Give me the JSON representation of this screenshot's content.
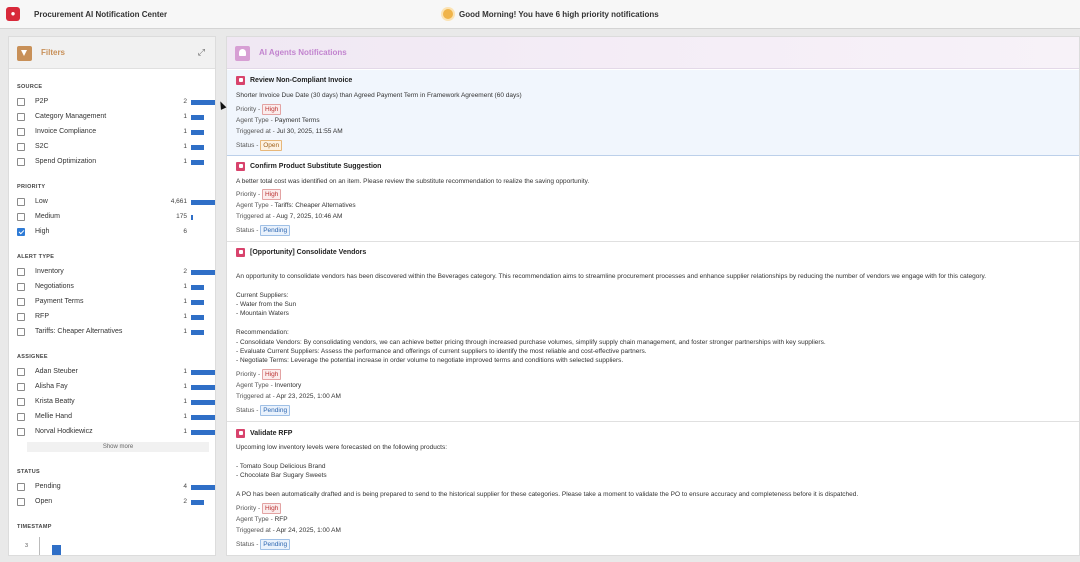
{
  "app": {
    "title": "Procurement AI Notification Center",
    "greeting": "Good Morning! You have 6 high priority notifications"
  },
  "colors": {
    "brand": "#d8293a",
    "filter_accent": "#c89058",
    "notif_accent": "#c284cf",
    "bar": "#2f6fc7",
    "priority_icon": "#d8436c"
  },
  "filters": {
    "title": "Filters",
    "show_more": "Show more",
    "source": {
      "title": "SOURCE",
      "items": [
        {
          "label": "P2P",
          "count": "2",
          "value": 2
        },
        {
          "label": "Category Management",
          "count": "1",
          "value": 1
        },
        {
          "label": "Invoice Compliance",
          "count": "1",
          "value": 1
        },
        {
          "label": "S2C",
          "count": "1",
          "value": 1
        },
        {
          "label": "Spend Optimization",
          "count": "1",
          "value": 1
        }
      ]
    },
    "priority": {
      "title": "PRIORITY",
      "items": [
        {
          "label": "Low",
          "count": "4,661",
          "value": 4661,
          "checked": false
        },
        {
          "label": "Medium",
          "count": "175",
          "value": 175,
          "checked": false
        },
        {
          "label": "High",
          "count": "6",
          "value": 6,
          "checked": true
        }
      ]
    },
    "alert_type": {
      "title": "ALERT TYPE",
      "items": [
        {
          "label": "Inventory",
          "count": "2",
          "value": 2
        },
        {
          "label": "Negotiations",
          "count": "1",
          "value": 1
        },
        {
          "label": "Payment Terms",
          "count": "1",
          "value": 1
        },
        {
          "label": "RFP",
          "count": "1",
          "value": 1
        },
        {
          "label": "Tariffs: Cheaper Alternatives",
          "count": "1",
          "value": 1
        }
      ]
    },
    "assignee": {
      "title": "ASSIGNEE",
      "items": [
        {
          "label": "Adan Steuber",
          "count": "1",
          "value": 1
        },
        {
          "label": "Alisha Fay",
          "count": "1",
          "value": 1
        },
        {
          "label": "Krista Beatty",
          "count": "1",
          "value": 1
        },
        {
          "label": "Mellie Hand",
          "count": "1",
          "value": 1
        },
        {
          "label": "Norval Hodkiewicz",
          "count": "1",
          "value": 1
        }
      ]
    },
    "status": {
      "title": "STATUS",
      "items": [
        {
          "label": "Pending",
          "count": "4",
          "value": 4
        },
        {
          "label": "Open",
          "count": "2",
          "value": 2
        }
      ]
    },
    "timestamp": {
      "title": "TIMESTAMP",
      "axis_label": "3"
    }
  },
  "notifications": {
    "title": "AI Agents Notifications",
    "labels": {
      "priority": "Priority -",
      "agent_type": "Agent Type -",
      "triggered_at": "Triggered at -",
      "status": "Status -"
    },
    "cards": [
      {
        "title": "Review Non-Compliant Invoice",
        "body": [
          "Shorter Invoice Due Date  (30 days) than Agreed Payment Term in Framework Agreement (60 days)"
        ],
        "priority": "High",
        "agent_type": "Payment Terms",
        "triggered_at": "Jul 30, 2025, 11:55 AM",
        "status": "Open"
      },
      {
        "title": "Confirm Product Substitute Suggestion",
        "body": [
          "A better total cost was identified on an item. Please review the substitute recommendation to realize the saving opportunity."
        ],
        "priority": "High",
        "agent_type": "Tariffs: Cheaper Alternatives",
        "triggered_at": "Aug 7, 2025, 10:46 AM",
        "status": "Pending"
      },
      {
        "title": "[Opportunity] Consolidate Vendors",
        "body": [
          "An opportunity to consolidate vendors has been discovered within the Beverages category. This recommendation aims to streamline procurement processes and enhance supplier relationships by reducing the number of vendors we engage with for this category.",
          "Current Suppliers:",
          "- Water from the Sun",
          "- Mountain Waters",
          "Recommendation:",
          "- Consolidate Vendors: By consolidating vendors, we can achieve better pricing through increased purchase volumes, simplify supply chain management, and foster stronger partnerships with key suppliers.",
          "- Evaluate Current Suppliers: Assess the performance and offerings of current suppliers to identify the most reliable and cost-effective partners.",
          "- Negotiate Terms: Leverage the potential increase in order volume to negotiate improved terms and conditions with selected suppliers."
        ],
        "priority": "High",
        "agent_type": "Inventory",
        "triggered_at": "Apr 23, 2025, 1:00 AM",
        "status": "Pending"
      },
      {
        "title": "Validate RFP",
        "body": [
          "Upcoming low inventory levels were forecasted on the following products:",
          "- Tomato Soup Delicious Brand",
          "- Chocolate Bar Sugary Sweets",
          "A PO has been automatically drafted and is being prepared to send to the historical supplier for these categories. Please take a moment to validate the PO to ensure accuracy and completeness before it is dispatched."
        ],
        "priority": "High",
        "agent_type": "RFP",
        "triggered_at": "Apr 24, 2025, 1:00 AM",
        "status": "Pending"
      }
    ]
  }
}
